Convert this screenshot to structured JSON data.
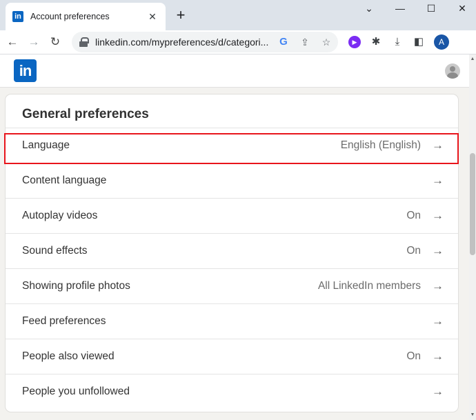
{
  "browser": {
    "tab_title": "Account preferences",
    "tab_favicon": "in",
    "close_glyph": "✕",
    "new_tab_glyph": "+",
    "url": "linkedin.com/mypreferences/d/categori...",
    "profile_initial": "A",
    "icons": [
      "back-arrow-icon",
      "forward-arrow-icon",
      "reload-icon",
      "lock-icon",
      "google-icon",
      "share-icon",
      "star-icon",
      "extension-icon",
      "puzzle-icon",
      "download-icon",
      "sidepanel-icon",
      "profile-icon"
    ]
  },
  "linkedin": {
    "logo": "in"
  },
  "preferences": {
    "title": "General preferences",
    "rows": [
      {
        "label": "Language",
        "value": "English (English)"
      },
      {
        "label": "Content language",
        "value": ""
      },
      {
        "label": "Autoplay videos",
        "value": "On"
      },
      {
        "label": "Sound effects",
        "value": "On"
      },
      {
        "label": "Showing profile photos",
        "value": "All LinkedIn members"
      },
      {
        "label": "Feed preferences",
        "value": ""
      },
      {
        "label": "People also viewed",
        "value": "On"
      },
      {
        "label": "People you unfollowed",
        "value": ""
      }
    ]
  },
  "colors": {
    "linkedin_blue": "#0a66c2",
    "highlight_red": "#e8141b"
  }
}
